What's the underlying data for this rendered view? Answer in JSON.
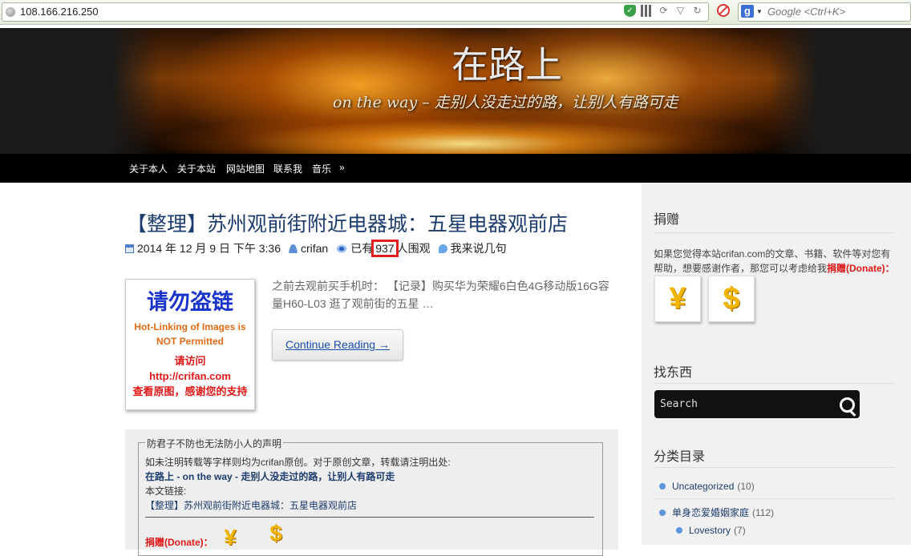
{
  "browser": {
    "url": "108.166.216.250",
    "search_placeholder": "Google <Ctrl+K>",
    "search_engine_badge": "g"
  },
  "header": {
    "site_title": "在路上",
    "tagline": "on the way – 走别人没走过的路，让别人有路可走"
  },
  "nav": {
    "items": [
      "关于本人",
      "关于本站",
      "网站地图",
      "联系我",
      "音乐"
    ],
    "more": "»"
  },
  "post": {
    "title": "【整理】苏州观前街附近电器城：五星电器观前店",
    "date": "2014 年 12 月 9 日 下午 3:36",
    "author": "crifan",
    "views_prefix": "已有",
    "views": "937",
    "views_suffix": "人围观",
    "comments": "我来说几句",
    "thumbnail": {
      "line1": "请勿盗链",
      "line2a": "Hot-Linking of Images is",
      "line2b": "NOT Permitted",
      "line3a": "请访问",
      "line3b": "http://crifan.com",
      "line3c": "查看原图，感谢您的支持"
    },
    "excerpt": "之前去观前买手机时： 【记录】购买华为荣耀6白色4G移动版16G容量H60-L03 逛了观前街的五星 …",
    "continue_label": "Continue Reading →",
    "declaration": {
      "legend": "防君子不防也无法防小人的声明",
      "line1": "如未注明转载等字样则均为crifan原创。对于原创文章，转载请注明出处:",
      "line2": "在路上 - on the way - 走别人没走过的路，让别人有路可走",
      "line3": "本文链接:",
      "line4": "【整理】苏州观前街附近电器城：五星电器观前店",
      "donate_label": "捐赠(Donate)：",
      "yuan_symbol": "¥",
      "dollar_symbol": "$"
    }
  },
  "sidebar": {
    "donate_heading": "捐赠",
    "donate_text_before": "如果您觉得本站crifan.com的文章、书籍、软件等对您有帮助，想要感谢作者，那您可以考虑给我",
    "donate_link": "捐赠(Donate)：",
    "yuan_symbol": "¥",
    "dollar_symbol": "$",
    "find_heading": "找东西",
    "search_placeholder": "Search",
    "categories_heading": "分类目录",
    "categories": [
      {
        "name": "Uncategorized",
        "count": "(10)"
      },
      {
        "name": "单身恋爱婚姻家庭",
        "count": "(112)"
      },
      {
        "name": "Lovestory",
        "count": "(7)"
      }
    ]
  }
}
